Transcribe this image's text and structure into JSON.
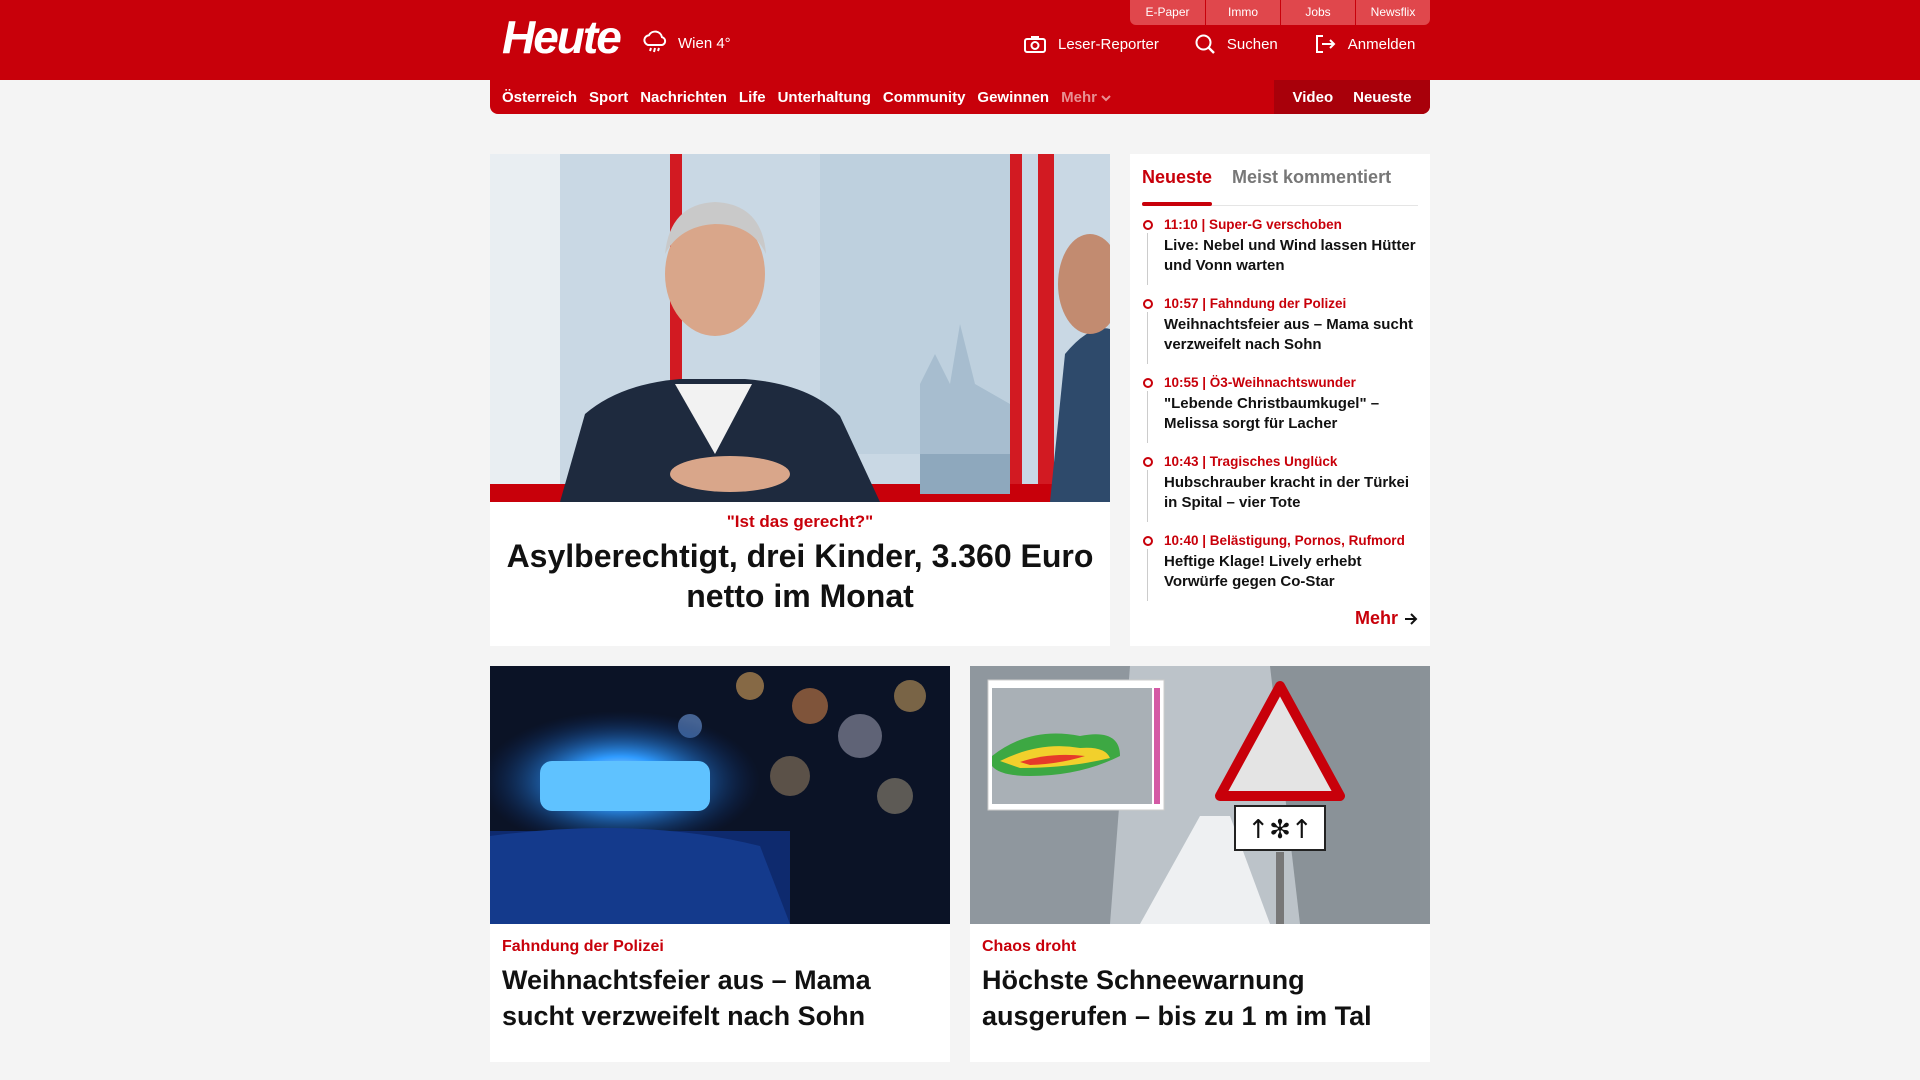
{
  "header": {
    "logo": "Heute",
    "weather": "Wien 4°",
    "utility_links": [
      "E-Paper",
      "Immo",
      "Jobs",
      "Newsflix"
    ],
    "actions": {
      "reporter": "Leser-Reporter",
      "search": "Suchen",
      "login": "Anmelden"
    }
  },
  "nav": {
    "items": [
      "Österreich",
      "Sport",
      "Nachrichten",
      "Life",
      "Unterhaltung",
      "Community",
      "Gewinnen"
    ],
    "more": "Mehr",
    "right": [
      "Video",
      "Neueste"
    ]
  },
  "hero": {
    "kicker": "\"Ist das gerecht?\"",
    "title": "Asylberechtigt, drei Kinder, 3.360 Euro netto im Monat"
  },
  "sidebar": {
    "tabs": [
      "Neueste",
      "Meist kommentiert"
    ],
    "items": [
      {
        "meta": "11:10 | Super-G verschoben",
        "title": "Live: Nebel und Wind lassen Hütter und Vonn warten"
      },
      {
        "meta": "10:57 | Fahndung der Polizei",
        "title": "Weihnachtsfeier aus – Mama sucht verzweifelt nach Sohn"
      },
      {
        "meta": "10:55 | Ö3-Weihnachtswunder",
        "title": "\"Lebende Christbaumkugel\" – Melissa sorgt für Lacher"
      },
      {
        "meta": "10:43 | Tragisches Unglück",
        "title": "Hubschrauber kracht in der Türkei in Spital – vier Tote"
      },
      {
        "meta": "10:40 | Belästigung, Pornos, Rufmord",
        "title": "Heftige Klage! Lively erhebt Vorwürfe gegen Co-Star"
      }
    ],
    "more": "Mehr"
  },
  "cards": [
    {
      "kicker": "Fahndung der Polizei",
      "title": "Weihnachtsfeier aus – Mama sucht verzweifelt nach Sohn"
    },
    {
      "kicker": "Chaos droht",
      "title": "Höchste Schneewarnung ausgerufen – bis zu 1 m im Tal"
    }
  ],
  "colors": {
    "brand": "#c8000a",
    "background": "#f4f4f4"
  }
}
